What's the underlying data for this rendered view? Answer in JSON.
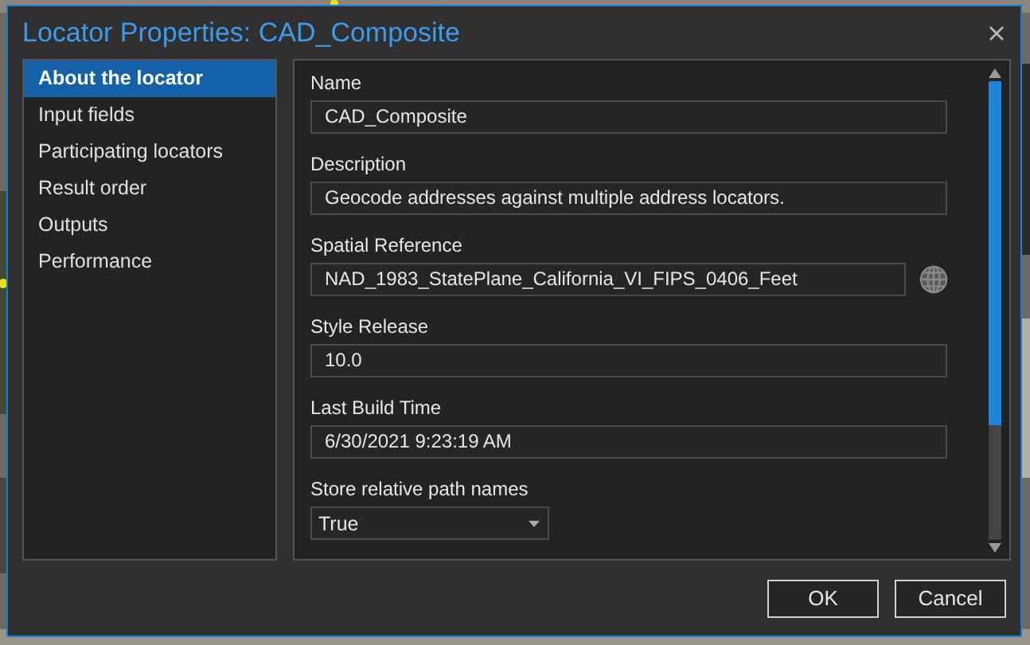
{
  "window": {
    "title": "Locator Properties: CAD_Composite"
  },
  "sidebar": {
    "items": [
      {
        "label": "About the locator",
        "selected": true
      },
      {
        "label": "Input fields",
        "selected": false
      },
      {
        "label": "Participating locators",
        "selected": false
      },
      {
        "label": "Result order",
        "selected": false
      },
      {
        "label": "Outputs",
        "selected": false
      },
      {
        "label": "Performance",
        "selected": false
      }
    ]
  },
  "fields": [
    {
      "kind": "text",
      "label": "Name",
      "value": "CAD_Composite"
    },
    {
      "kind": "text",
      "label": "Description",
      "value": "Geocode addresses against multiple address locators."
    },
    {
      "kind": "spatial",
      "label": "Spatial Reference",
      "value": "NAD_1983_StatePlane_California_VI_FIPS_0406_Feet"
    },
    {
      "kind": "text",
      "label": "Style Release",
      "value": "10.0"
    },
    {
      "kind": "text",
      "label": "Last Build Time",
      "value": "6/30/2021 9:23:19 AM"
    },
    {
      "kind": "dropdown",
      "label": "Store relative path names",
      "value": "True"
    }
  ],
  "buttons": [
    "OK",
    "Cancel"
  ]
}
